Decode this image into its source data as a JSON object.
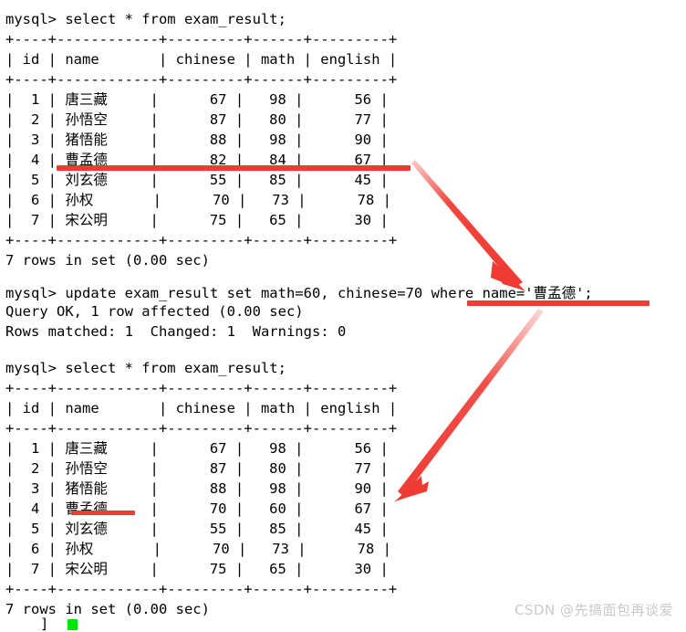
{
  "terminal": {
    "prompt": "mysql> ",
    "commands": {
      "select": "select * from exam_result;",
      "update": "update exam_result set math=60, chinese=70 where name='曹孟德';"
    },
    "table_border": "+----+------------+---------+------+---------+",
    "header_row": "| id | name       | chinese | math | english |",
    "columns": [
      "id",
      "name",
      "chinese",
      "math",
      "english"
    ],
    "result_footer": "7 rows in set (0.00 sec)",
    "update_response": {
      "query_ok": "Query OK, 1 row affected (0.00 sec)",
      "rows_matched": "Rows matched: 1  Changed: 1  Warnings: 0"
    },
    "first_result": {
      "rows": [
        {
          "id": "1",
          "name": "唐三藏",
          "chinese": "67",
          "math": "98",
          "english": "56"
        },
        {
          "id": "2",
          "name": "孙悟空",
          "chinese": "87",
          "math": "80",
          "english": "77"
        },
        {
          "id": "3",
          "name": "猪悟能",
          "chinese": "88",
          "math": "98",
          "english": "90"
        },
        {
          "id": "4",
          "name": "曹孟德",
          "chinese": "82",
          "math": "84",
          "english": "67"
        },
        {
          "id": "5",
          "name": "刘玄德",
          "chinese": "55",
          "math": "85",
          "english": "45"
        },
        {
          "id": "6",
          "name": "孙权",
          "chinese": "70",
          "math": "73",
          "english": "78"
        },
        {
          "id": "7",
          "name": "宋公明",
          "chinese": "75",
          "math": "65",
          "english": "30"
        }
      ]
    },
    "second_result": {
      "rows": [
        {
          "id": "1",
          "name": "唐三藏",
          "chinese": "67",
          "math": "98",
          "english": "56"
        },
        {
          "id": "2",
          "name": "孙悟空",
          "chinese": "87",
          "math": "80",
          "english": "77"
        },
        {
          "id": "3",
          "name": "猪悟能",
          "chinese": "88",
          "math": "98",
          "english": "90"
        },
        {
          "id": "4",
          "name": "曹孟德",
          "chinese": "70",
          "math": "60",
          "english": "67"
        },
        {
          "id": "5",
          "name": "刘玄德",
          "chinese": "55",
          "math": "85",
          "english": "45"
        },
        {
          "id": "6",
          "name": "孙权",
          "chinese": "70",
          "math": "73",
          "english": "78"
        },
        {
          "id": "7",
          "name": "宋公明",
          "chinese": "75",
          "math": "65",
          "english": "30"
        }
      ]
    },
    "cursor": "▮"
  },
  "lines": {
    "l01": "mysql> select * from exam_result;",
    "l02": "+----+------------+---------+------+---------+",
    "l03": "| id | name       | chinese | math | english |",
    "l04": "+----+------------+---------+------+---------+",
    "l05_a": "|  1 | ",
    "l05_n": "唐三藏",
    "l05_b": "     |      67 |   98 |      56 |",
    "l06_a": "|  2 | ",
    "l06_n": "孙悟空",
    "l06_b": "     |      87 |   80 |      77 |",
    "l07_a": "|  3 | ",
    "l07_n": "猪悟能",
    "l07_b": "     |      88 |   98 |      90 |",
    "l08_a": "|  4 | ",
    "l08_n": "曹孟德",
    "l08_b": "     |      82 |   84 |      67 |",
    "l09_a": "|  5 | ",
    "l09_n": "刘玄德",
    "l09_b": "     |      55 |   85 |      45 |",
    "l10_a": "|  6 | ",
    "l10_n": "孙权",
    "l10_b": "       |      70 |   73 |      78 |",
    "l11_a": "|  7 | ",
    "l11_n": "宋公明",
    "l11_b": "     |      75 |   65 |      30 |",
    "l12": "+----+------------+---------+------+---------+",
    "l13": "7 rows in set (0.00 sec)",
    "l14_a": "mysql> update exam_result set math=60, chinese=70 where name='",
    "l14_n": "曹孟德",
    "l14_b": "';",
    "l15": "Query OK, 1 row affected (0.00 sec)",
    "l16": "Rows matched: 1  Changed: 1  Warnings: 0",
    "l17": "mysql> select * from exam_result;",
    "l18": "+----+------------+---------+------+---------+",
    "l19": "| id | name       | chinese | math | english |",
    "l20": "+----+------------+---------+------+---------+",
    "l21_a": "|  1 | ",
    "l21_n": "唐三藏",
    "l21_b": "     |      67 |   98 |      56 |",
    "l22_a": "|  2 | ",
    "l22_n": "孙悟空",
    "l22_b": "     |      87 |   80 |      77 |",
    "l23_a": "|  3 | ",
    "l23_n": "猪悟能",
    "l23_b": "     |      88 |   98 |      90 |",
    "l24_a": "|  4 | ",
    "l24_n": "曹孟德",
    "l24_b": "     |      70 |   60 |      67 |",
    "l25_a": "|  5 | ",
    "l25_n": "刘玄德",
    "l25_b": "     |      55 |   85 |      45 |",
    "l26_a": "|  6 | ",
    "l26_n": "孙权",
    "l26_b": "       |      70 |   73 |      78 |",
    "l27_a": "|  7 | ",
    "l27_n": "宋公明",
    "l27_b": "     |      75 |   65 |      30 |",
    "l28": "+----+------------+---------+------+---------+",
    "l29": "7 rows in set (0.00 sec)",
    "l30": "]"
  },
  "annotations": {
    "color": "#ef3b33",
    "strikethrough_row5_label": "strikethrough over first-table row 5 boundary",
    "underline_update_label": "underline under update where-clause",
    "underline_name_label": "underline under name in second table row 4",
    "arrow1_label": "arrow from first table row 4/5 to update where-clause",
    "arrow2_label": "arrow from update statement to second table row 4"
  },
  "watermark": {
    "text": "CSDN @先搞面包再谈爱",
    "color": "#c9c9c9"
  },
  "cursor": {
    "color": "#00e500"
  }
}
